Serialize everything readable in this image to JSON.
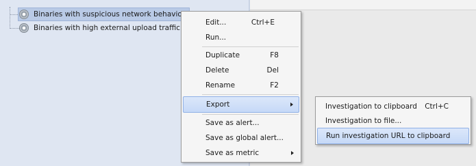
{
  "tree": {
    "items": [
      {
        "label": "Binaries with suspicious network behavior",
        "icon": "gear-icon",
        "selected": true
      },
      {
        "label": "Binaries with high external upload traffic",
        "icon": "gear-icon",
        "selected": false
      }
    ]
  },
  "context_menu": {
    "items": [
      {
        "label": "Edit...",
        "shortcut": "Ctrl+E"
      },
      {
        "label": "Run...",
        "shortcut": ""
      },
      {
        "label": "Duplicate",
        "shortcut": "F8"
      },
      {
        "label": "Delete",
        "shortcut": "Del"
      },
      {
        "label": "Rename",
        "shortcut": "F2"
      },
      {
        "label": "Export",
        "shortcut": "",
        "submenu": true
      },
      {
        "label": "Save as alert...",
        "shortcut": ""
      },
      {
        "label": "Save as global alert...",
        "shortcut": ""
      },
      {
        "label": "Save as metric",
        "shortcut": "",
        "submenu": true
      }
    ]
  },
  "export_submenu": {
    "items": [
      {
        "label": "Investigation to clipboard",
        "shortcut": "Ctrl+C"
      },
      {
        "label": "Investigation to file...",
        "shortcut": ""
      },
      {
        "label": "Run investigation URL to clipboard",
        "shortcut": ""
      }
    ]
  },
  "colors": {
    "selection": "#b9cae6",
    "menu_highlight": "#c6d9f7",
    "tree_background": "#dfe6f2"
  }
}
